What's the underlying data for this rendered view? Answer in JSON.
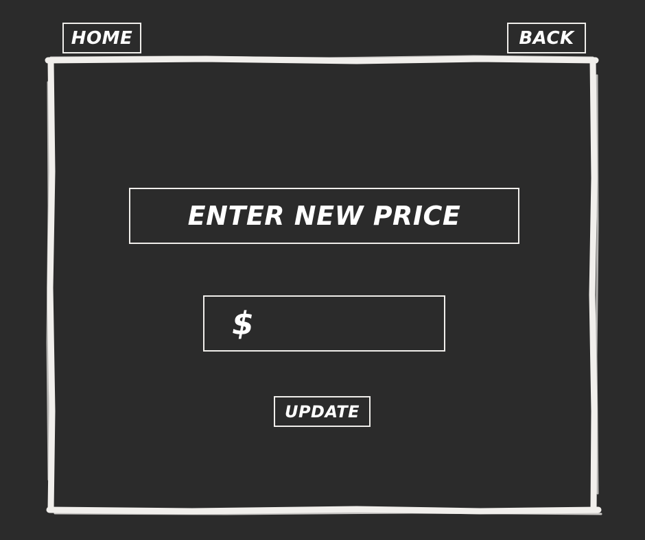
{
  "nav": {
    "home_label": "HOME",
    "back_label": "BACK"
  },
  "form": {
    "title": "ENTER NEW PRICE",
    "currency_symbol": "$",
    "price_value": "",
    "update_label": "UPDATE"
  },
  "colors": {
    "background": "#2b2b2b",
    "foreground": "#f1efec"
  }
}
